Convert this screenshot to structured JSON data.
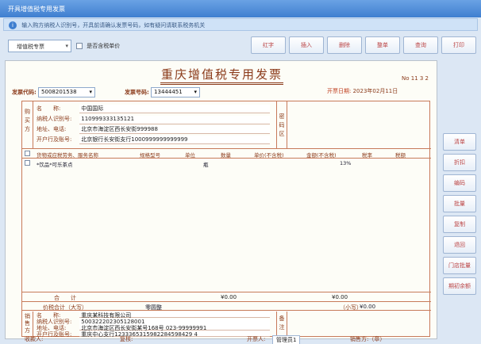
{
  "window": {
    "title": "开具增值税专用发票"
  },
  "notice": {
    "text": "输入购方纳税人识别号，开具前请确认发票号码，如有疑问请联系税务机关"
  },
  "toolbar": {
    "invoice_type": "增值税专票",
    "checkbox_label": "是否含税单价",
    "buttons": [
      "红字",
      "插入",
      "删除",
      "整单",
      "查询",
      "打印"
    ]
  },
  "invoice": {
    "title": "重庆增值税专用发票",
    "number_label": "No",
    "number_value": "11 3 2",
    "code_label": "发票代码:",
    "code_value": "5008201538",
    "no_label": "发票号码:",
    "no_value": "13444451",
    "date_label": "开票日期:",
    "date_value": "2023年02月11日",
    "buyer": {
      "side_label": "购买方",
      "name_label": "名　　称:",
      "name_value": "中国国际",
      "tax_label": "纳税人识别号:",
      "tax_value": "110999333135121",
      "addr_label": "地址、电话:",
      "addr_value": "北京市海淀区西长安街999988",
      "bank_label": "开户行及账号:",
      "bank_value": "北京银行长安街支行1000999999999999"
    },
    "pwd_label": "密码区",
    "item_headers": [
      "货物或应税劳务、服务名称",
      "规格型号",
      "单位",
      "数量",
      "单价(不含税)",
      "金额(不含税)",
      "税率",
      "税额"
    ],
    "item_row": {
      "name": "*饮品*可乐茶点",
      "unit": "瓶",
      "rate": "13%"
    },
    "sum": {
      "label": "合　　计",
      "amount": "¥0.00",
      "tax": "¥0.00"
    },
    "total": {
      "label": "价税合计（大写）",
      "big_value": "零圆整",
      "small_label": "（小写）",
      "small_value": "¥0.00"
    },
    "seller": {
      "side_label": "销售方",
      "name_label": "名　　称:",
      "name_value": "重庆某科技有限公司",
      "tax_label": "纳税人识别号:",
      "tax_value": "500322202305128001",
      "addr_label": "地址、电话:",
      "addr_value": "北京市海淀区西长安街某号168号 023-99999991",
      "bank_label": "开户行及账号:",
      "bank_value": "重庆中心支行1233365315982284598429 4"
    },
    "remark_label": "备注",
    "footer": {
      "payee_label": "收款人:",
      "reviewer_label": "复核:",
      "drawer_label": "开票人:",
      "drawer_value": "管理员1",
      "seller_label": "销售方:（章）"
    }
  },
  "side_buttons": [
    "清单",
    "折扣",
    "编码",
    "批量",
    "复制",
    "退回",
    "门店批量",
    "期初余额"
  ]
}
